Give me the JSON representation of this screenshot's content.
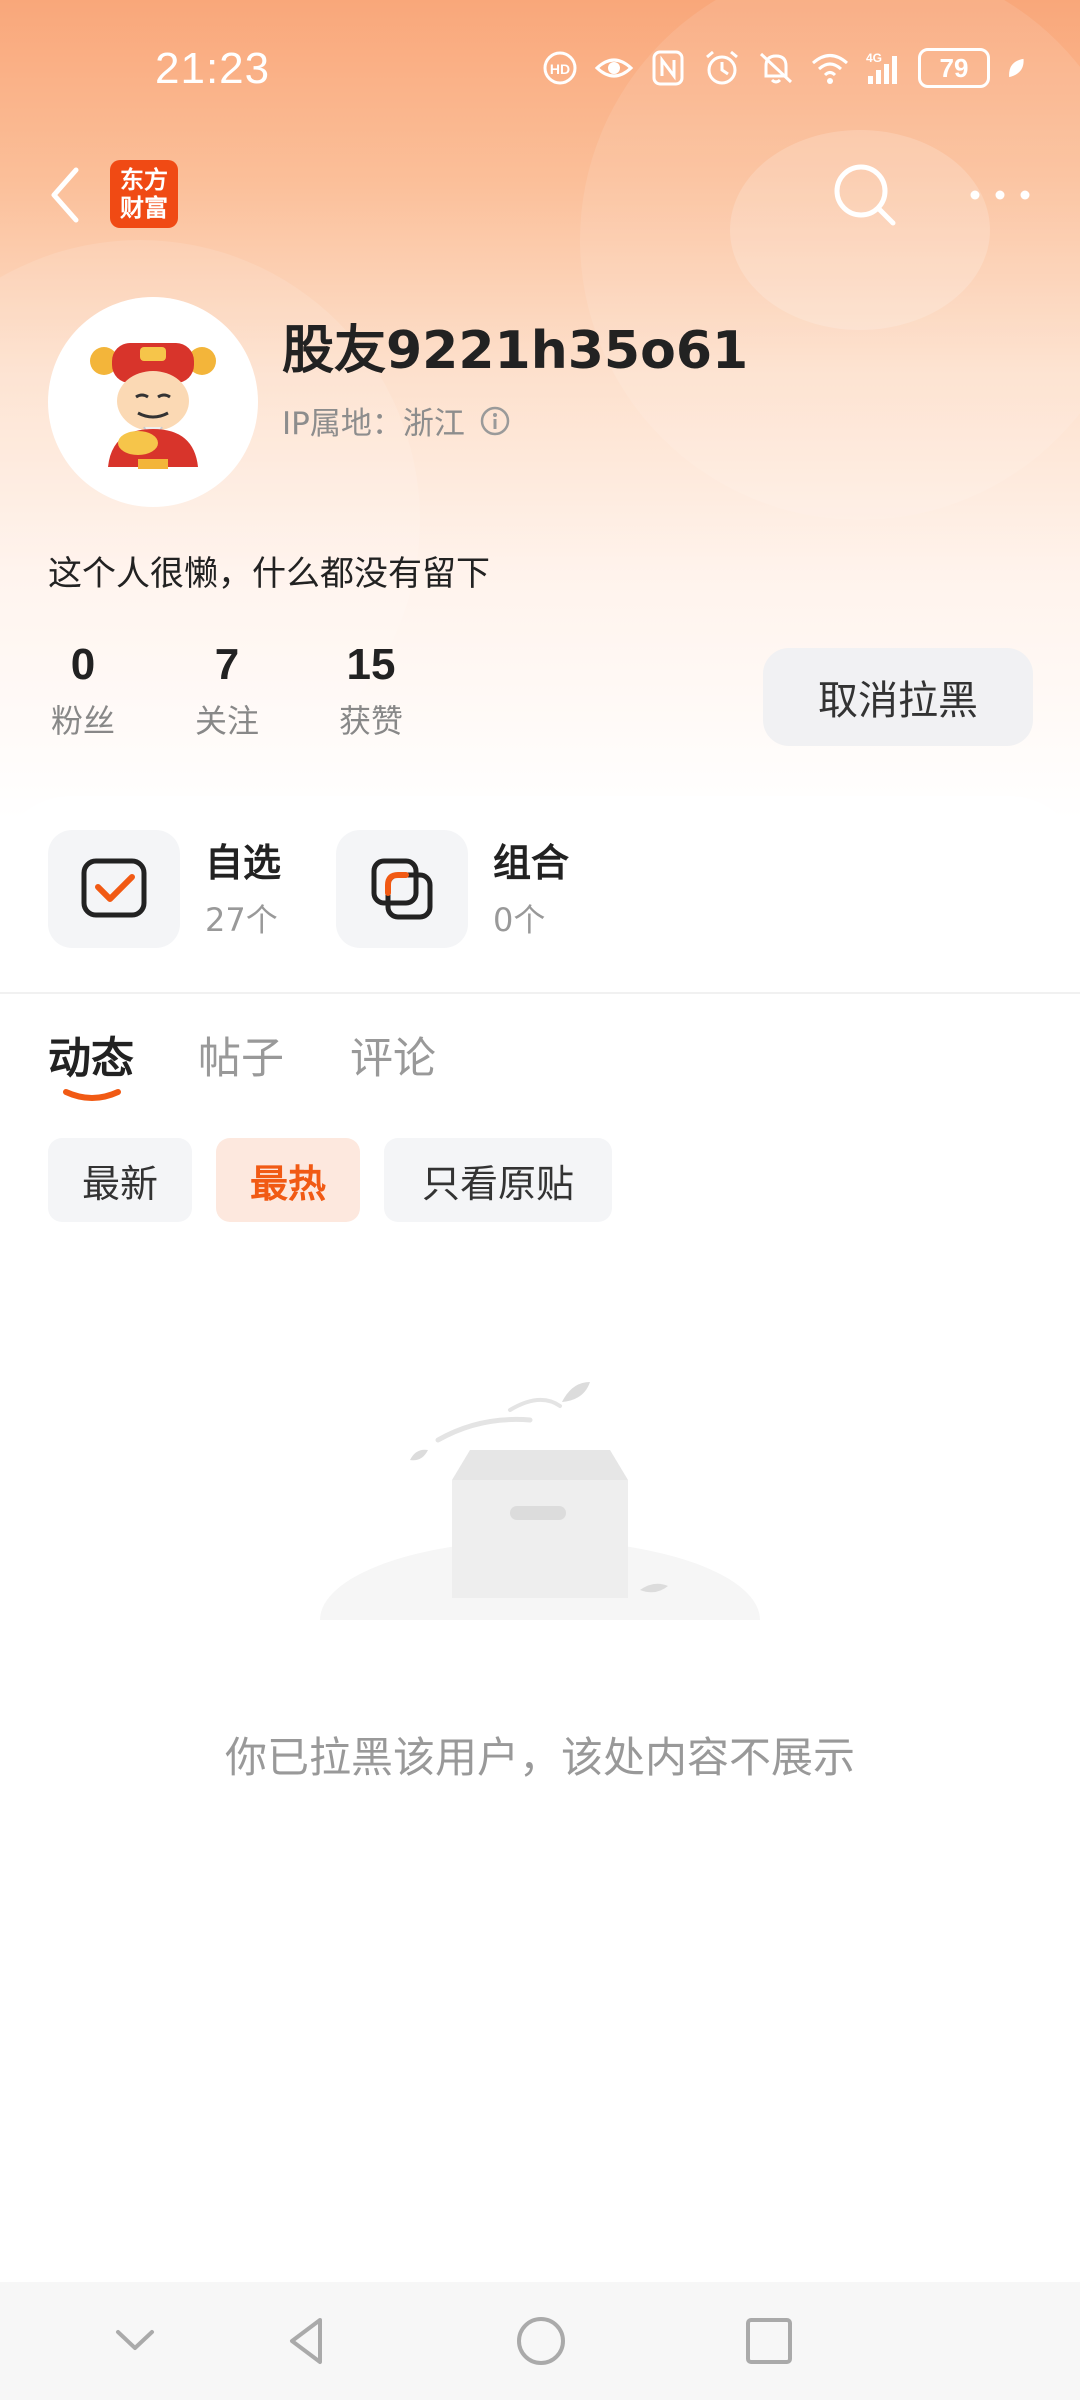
{
  "status_bar": {
    "time": "21:23",
    "battery": "79",
    "icons": [
      "nfc-icon",
      "eye-icon",
      "n-icon",
      "alarm-icon",
      "mute-icon",
      "wifi-icon",
      "signal-4g-icon",
      "battery-icon",
      "leaf-icon"
    ]
  },
  "nav": {
    "logo_line1": "东方",
    "logo_line2": "财富"
  },
  "profile": {
    "username": "股友9221h35o61",
    "ip_label": "IP属地：浙江",
    "bio": "这个人很懒，什么都没有留下"
  },
  "stats": [
    {
      "value": "0",
      "label": "粉丝"
    },
    {
      "value": "7",
      "label": "关注"
    },
    {
      "value": "15",
      "label": "获赞"
    }
  ],
  "unblock_label": "取消拉黑",
  "collections": [
    {
      "title": "自选",
      "count": "27个"
    },
    {
      "title": "组合",
      "count": "0个"
    }
  ],
  "tabs": [
    {
      "label": "动态",
      "active": true
    },
    {
      "label": "帖子",
      "active": false
    },
    {
      "label": "评论",
      "active": false
    }
  ],
  "filters": [
    {
      "label": "最新",
      "active": false
    },
    {
      "label": "最热",
      "active": true
    },
    {
      "label": "只看原贴",
      "active": false
    }
  ],
  "empty_message": "你已拉黑该用户，该处内容不展示",
  "colors": {
    "accent": "#f15a14",
    "header_gradient_top": "#f9a77a"
  }
}
